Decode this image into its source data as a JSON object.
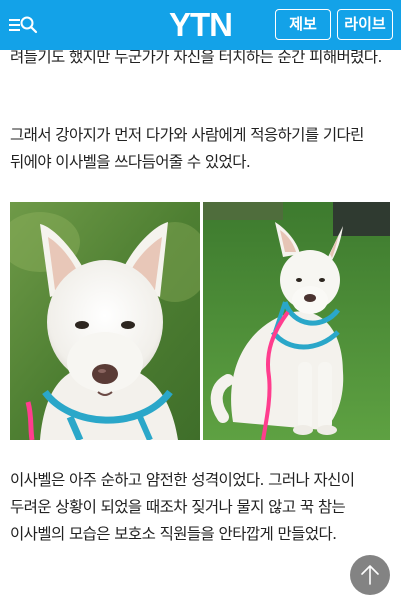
{
  "header": {
    "logo": "YTN",
    "report_button": "제보",
    "live_button": "라이브"
  },
  "article": {
    "paragraphs": [
      "려들기도 했지만 누군가가 자신을 터치하는 순간 피해버렸다.",
      "그래서 강아지가 먼저 다가와 사람에게 적응하기를 기다린 뒤에야 이사벨을 쓰다듬어줄 수 있었다.",
      "이사벨은 아주 순하고 얌전한 성격이었다. 그러나 자신이 두려운 상황이 되었을 때조차 짖거나 물지 않고 꾹 참는 이사벨의 모습은 보호소 직원들을 안타깝게 만들었다."
    ]
  },
  "icons": {
    "menu": "menu-icon",
    "search": "search-icon",
    "scroll_top": "arrow-up-icon"
  },
  "colors": {
    "header_bg": "#13a2e8",
    "text": "#222222",
    "leash": "#ff3d8e",
    "harness": "#2aa7c9"
  }
}
